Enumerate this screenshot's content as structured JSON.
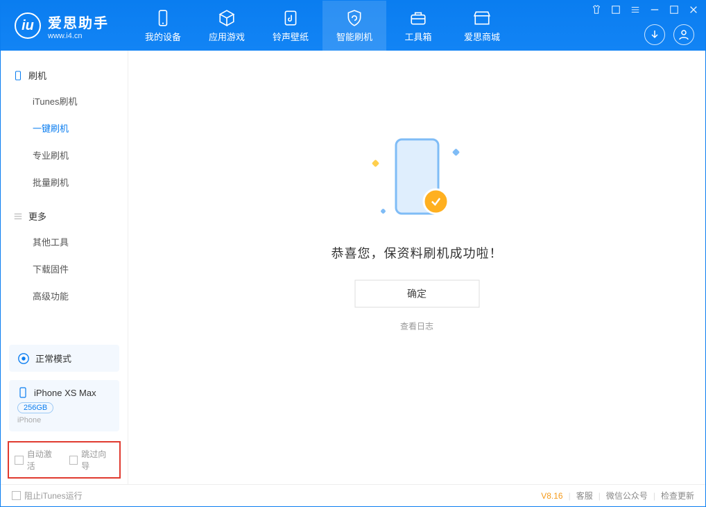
{
  "app": {
    "name_cn": "爱思助手",
    "name_en": "www.i4.cn"
  },
  "nav": {
    "items": [
      {
        "label": "我的设备"
      },
      {
        "label": "应用游戏"
      },
      {
        "label": "铃声壁纸"
      },
      {
        "label": "智能刷机"
      },
      {
        "label": "工具箱"
      },
      {
        "label": "爱思商城"
      }
    ]
  },
  "sidebar": {
    "section1": {
      "header": "刷机",
      "items": [
        {
          "label": "iTunes刷机"
        },
        {
          "label": "一键刷机"
        },
        {
          "label": "专业刷机"
        },
        {
          "label": "批量刷机"
        }
      ]
    },
    "section2": {
      "header": "更多",
      "items": [
        {
          "label": "其他工具"
        },
        {
          "label": "下载固件"
        },
        {
          "label": "高级功能"
        }
      ]
    },
    "mode": "正常模式",
    "device": {
      "name": "iPhone XS Max",
      "capacity": "256GB",
      "platform": "iPhone"
    },
    "checkboxes": {
      "auto_activate": "自动激活",
      "skip_guide": "跳过向导"
    }
  },
  "main": {
    "success_msg": "恭喜您，保资料刷机成功啦！",
    "ok_button": "确定",
    "view_log": "查看日志"
  },
  "footer": {
    "block_itunes": "阻止iTunes运行",
    "version": "V8.16",
    "links": {
      "service": "客服",
      "wechat": "微信公众号",
      "update": "检查更新"
    }
  }
}
